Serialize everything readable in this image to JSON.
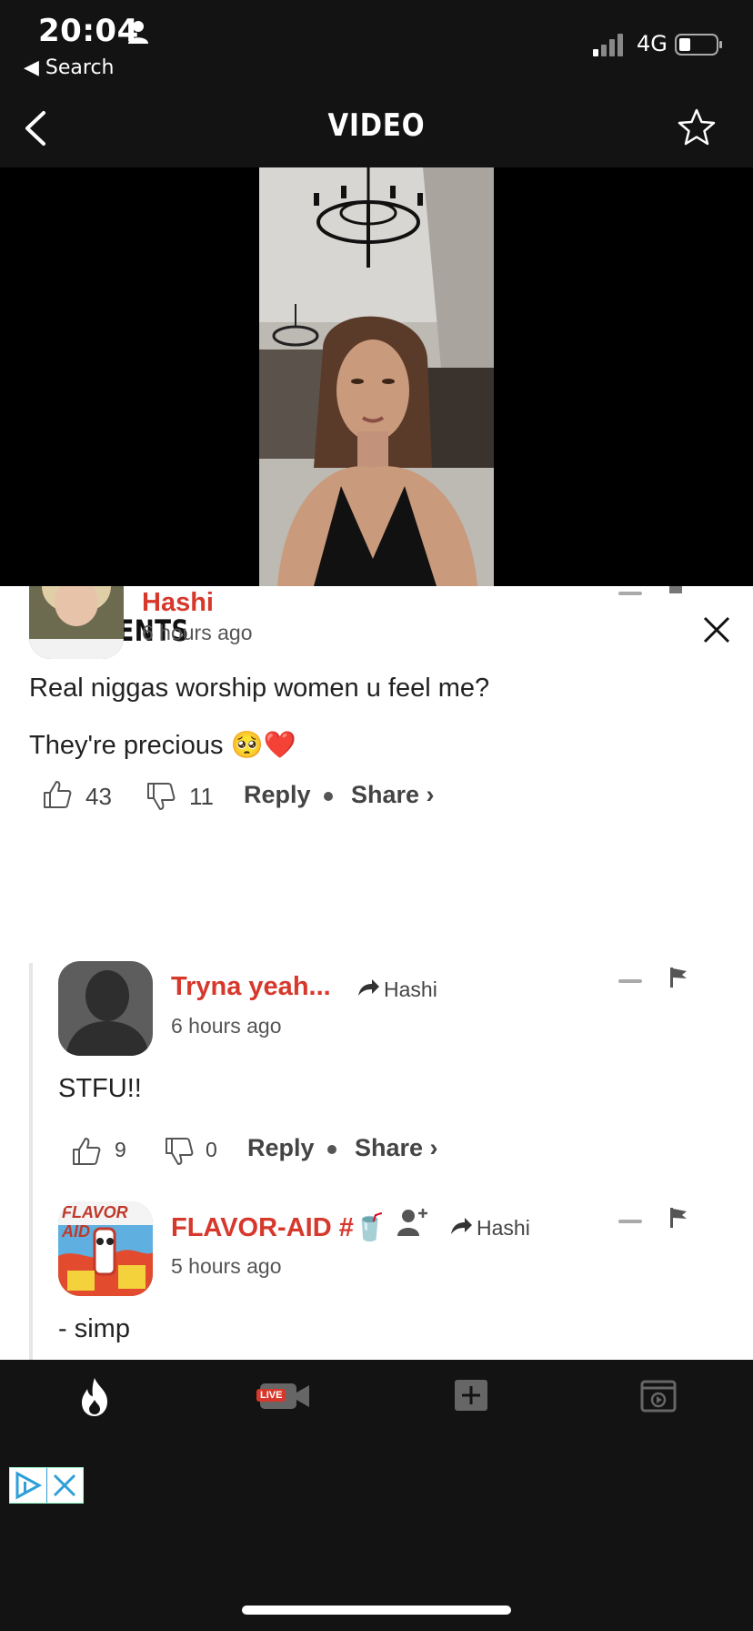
{
  "status_bar": {
    "time": "20:04",
    "back_label": "Search",
    "network": "4G"
  },
  "header": {
    "title": "VIDEO"
  },
  "comments_panel": {
    "title": "COMMENTS",
    "comments": [
      {
        "username": "Hashi",
        "time_ago": "6 hours ago",
        "text_line1": "Real niggas worship women u feel me?",
        "text_line2": "They're precious 🥺❤️",
        "likes": "43",
        "dislikes": "11",
        "reply_label": "Reply",
        "share_label": "Share ›"
      },
      {
        "username": "Tryna yeah...",
        "reply_to": "Hashi",
        "time_ago": "6 hours ago",
        "text": "STFU!!",
        "likes": "9",
        "dislikes": "0",
        "reply_label": "Reply",
        "share_label": "Share ›"
      },
      {
        "username": "FLAVOR-AID #🥤",
        "reply_to": "Hashi",
        "time_ago": "5 hours ago",
        "text": "- simp",
        "avatar_text": "FLAVOR AID"
      }
    ]
  },
  "bottom_nav": {
    "items": [
      {
        "icon": "flame-icon"
      },
      {
        "icon": "live-camera-icon",
        "badge": "LIVE"
      },
      {
        "icon": "plus-icon"
      },
      {
        "icon": "video-library-icon"
      }
    ]
  },
  "colors": {
    "accent": "#d6382c",
    "background_dark": "#131313"
  }
}
